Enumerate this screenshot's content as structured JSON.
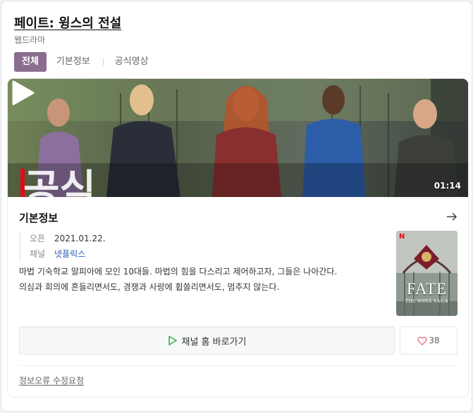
{
  "header": {
    "title": "페이트: 윙스의 전설",
    "subtitle": "웹드라마"
  },
  "tabs": [
    {
      "label": "전체",
      "active": true
    },
    {
      "label": "기본정보",
      "active": false
    },
    {
      "label": "공식영상",
      "active": false
    }
  ],
  "video": {
    "overlay_text": "공식",
    "duration": "01:14"
  },
  "info": {
    "title": "기본정보",
    "meta": [
      {
        "key": "오픈",
        "value": "2021.01.22."
      },
      {
        "key": "채널",
        "value": "넷플릭스"
      }
    ],
    "description_lines": [
      "마법 기숙학교 알피아에 모인 10대들. 마법의 힘을 다스리고 제어하고자, 그들은 나아간다.",
      "의심과 회의에 흔들리면서도, 경쟁과 사랑에 휩쓸리면서도, 멈추지 않는다."
    ],
    "poster": {
      "brand": "N",
      "title": "FATE",
      "subtitle": "THE WINX SAGA"
    }
  },
  "actions": {
    "home_label": "채널 홈 바로가기",
    "like_count": "38"
  },
  "footer": {
    "report_label": "정보오류 수정요청"
  },
  "colors": {
    "tab_active": "#8b6d8f",
    "link": "#2b62b8",
    "play_green": "#2fb34c",
    "heart": "#e86a7a"
  }
}
